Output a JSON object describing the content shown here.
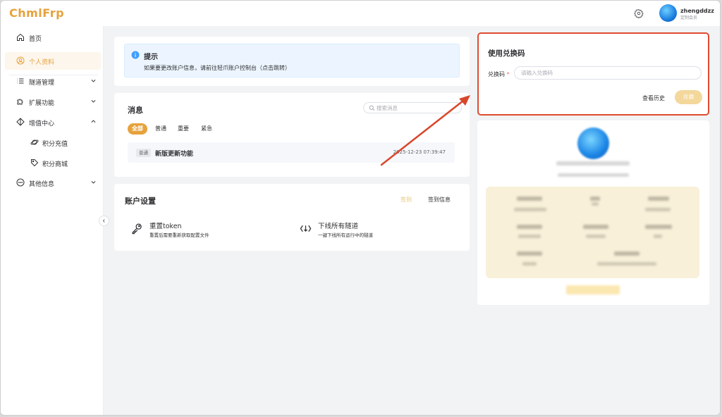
{
  "app": {
    "logo": "ChmlFrp"
  },
  "header": {
    "settings_icon": "gear-icon",
    "user": {
      "name": "zhengddzz",
      "group": "定制会员"
    }
  },
  "sidebar": {
    "items": [
      {
        "label": "首页",
        "icon": "home-icon"
      },
      {
        "label": "个人资料",
        "icon": "user-circle-icon",
        "active": true
      },
      {
        "label": "隧道管理",
        "icon": "list-icon",
        "expandable": true,
        "expanded": false
      },
      {
        "label": "扩展功能",
        "icon": "puzzle-icon",
        "expandable": true,
        "expanded": false
      },
      {
        "label": "增值中心",
        "icon": "diamond-icon",
        "expandable": true,
        "expanded": true
      },
      {
        "label": "积分充值",
        "icon": "planet-icon",
        "sub": true
      },
      {
        "label": "积分商城",
        "icon": "tag-icon",
        "sub": true
      },
      {
        "label": "其他信息",
        "icon": "dots-circle-icon",
        "expandable": true,
        "expanded": false
      }
    ]
  },
  "tip": {
    "title": "提示",
    "text": "如果要更改账户信息，请前往轻爪账户控制台（点击跳转）"
  },
  "messages": {
    "title": "消息",
    "search_placeholder": "搜索消息",
    "filters": [
      "全部",
      "普通",
      "重要",
      "紧急"
    ],
    "active_filter": "全部",
    "items": [
      {
        "tag": "普通",
        "title": "新版更新功能",
        "time": "2025-12-23 07:39:47"
      }
    ]
  },
  "account": {
    "title": "账户设置",
    "signin": "签到",
    "signin_info": "签到信息",
    "actions": [
      {
        "title": "重置token",
        "desc": "重置后需要重新获取配置文件",
        "icon": "key-icon"
      },
      {
        "title": "下线所有隧道",
        "desc": "一键下线所有运行中的隧道",
        "icon": "offline-arrows-icon"
      }
    ]
  },
  "redeem": {
    "title": "使用兑换码",
    "label": "兑换码",
    "required_mark": "*",
    "placeholder": "请输入兑换码",
    "history": "查看历史",
    "submit": "兑换"
  },
  "colors": {
    "accent": "#e6a23c",
    "highlight_border": "#e04b31",
    "info_bg": "#ecf5ff",
    "stats_bg": "#f8f0d9"
  }
}
